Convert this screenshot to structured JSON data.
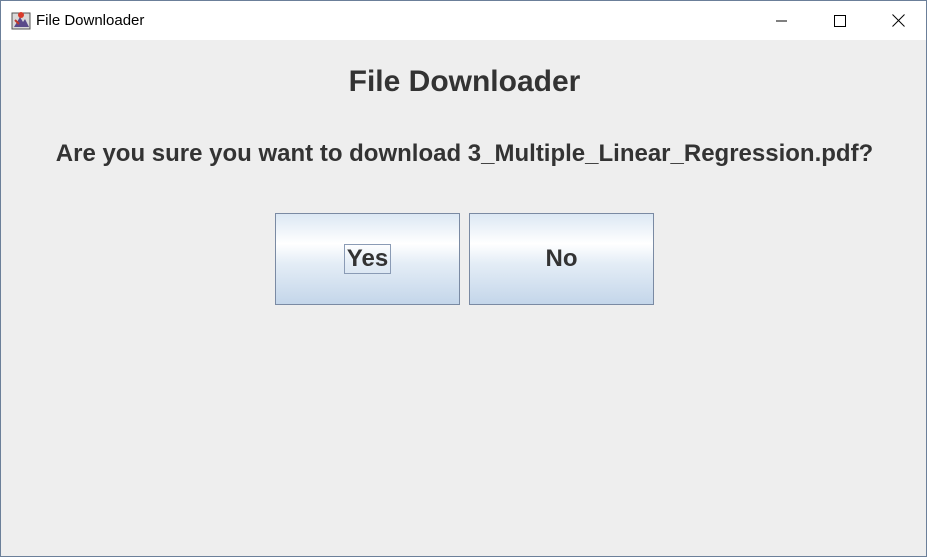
{
  "window": {
    "title": "File Downloader",
    "icon": "java-app-icon",
    "controls": {
      "minimize": "minimize-icon",
      "maximize": "maximize-icon",
      "close": "close-icon"
    }
  },
  "dialog": {
    "heading": "File Downloader",
    "question": "Are you sure you want to download 3_Multiple_Linear_Regression.pdf?",
    "buttons": {
      "yes_label": "Yes",
      "no_label": "No"
    },
    "focused_button": "Yes"
  },
  "colors": {
    "background": "#eeeeee",
    "text": "#333333",
    "button_border": "#7a8aa3",
    "button_gradient_bottom": "#c4d6ea"
  }
}
